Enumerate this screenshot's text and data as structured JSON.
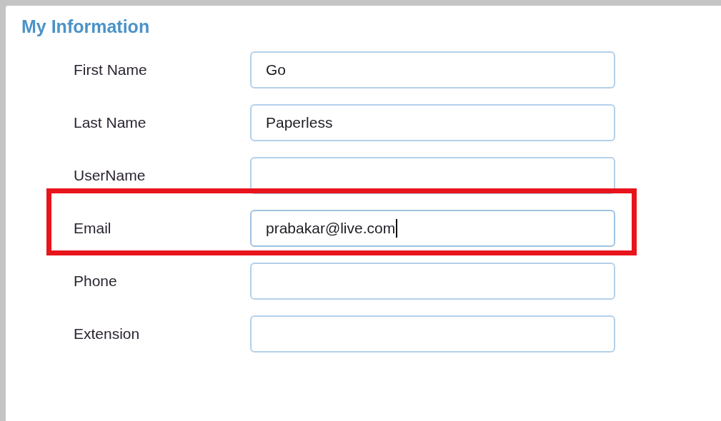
{
  "title": "My Information",
  "fields": [
    {
      "label": "First Name",
      "value": "Go",
      "focused": false,
      "highlighted": false
    },
    {
      "label": "Last Name",
      "value": "Paperless",
      "focused": false,
      "highlighted": false
    },
    {
      "label": "UserName",
      "focused": false,
      "highlighted": false
    },
    {
      "label": "Email",
      "value": "prabakar@live.com",
      "focused": true,
      "highlighted": true
    },
    {
      "label": "Phone",
      "focused": false,
      "highlighted": false
    },
    {
      "label": "Extension",
      "focused": false,
      "highlighted": false
    }
  ]
}
